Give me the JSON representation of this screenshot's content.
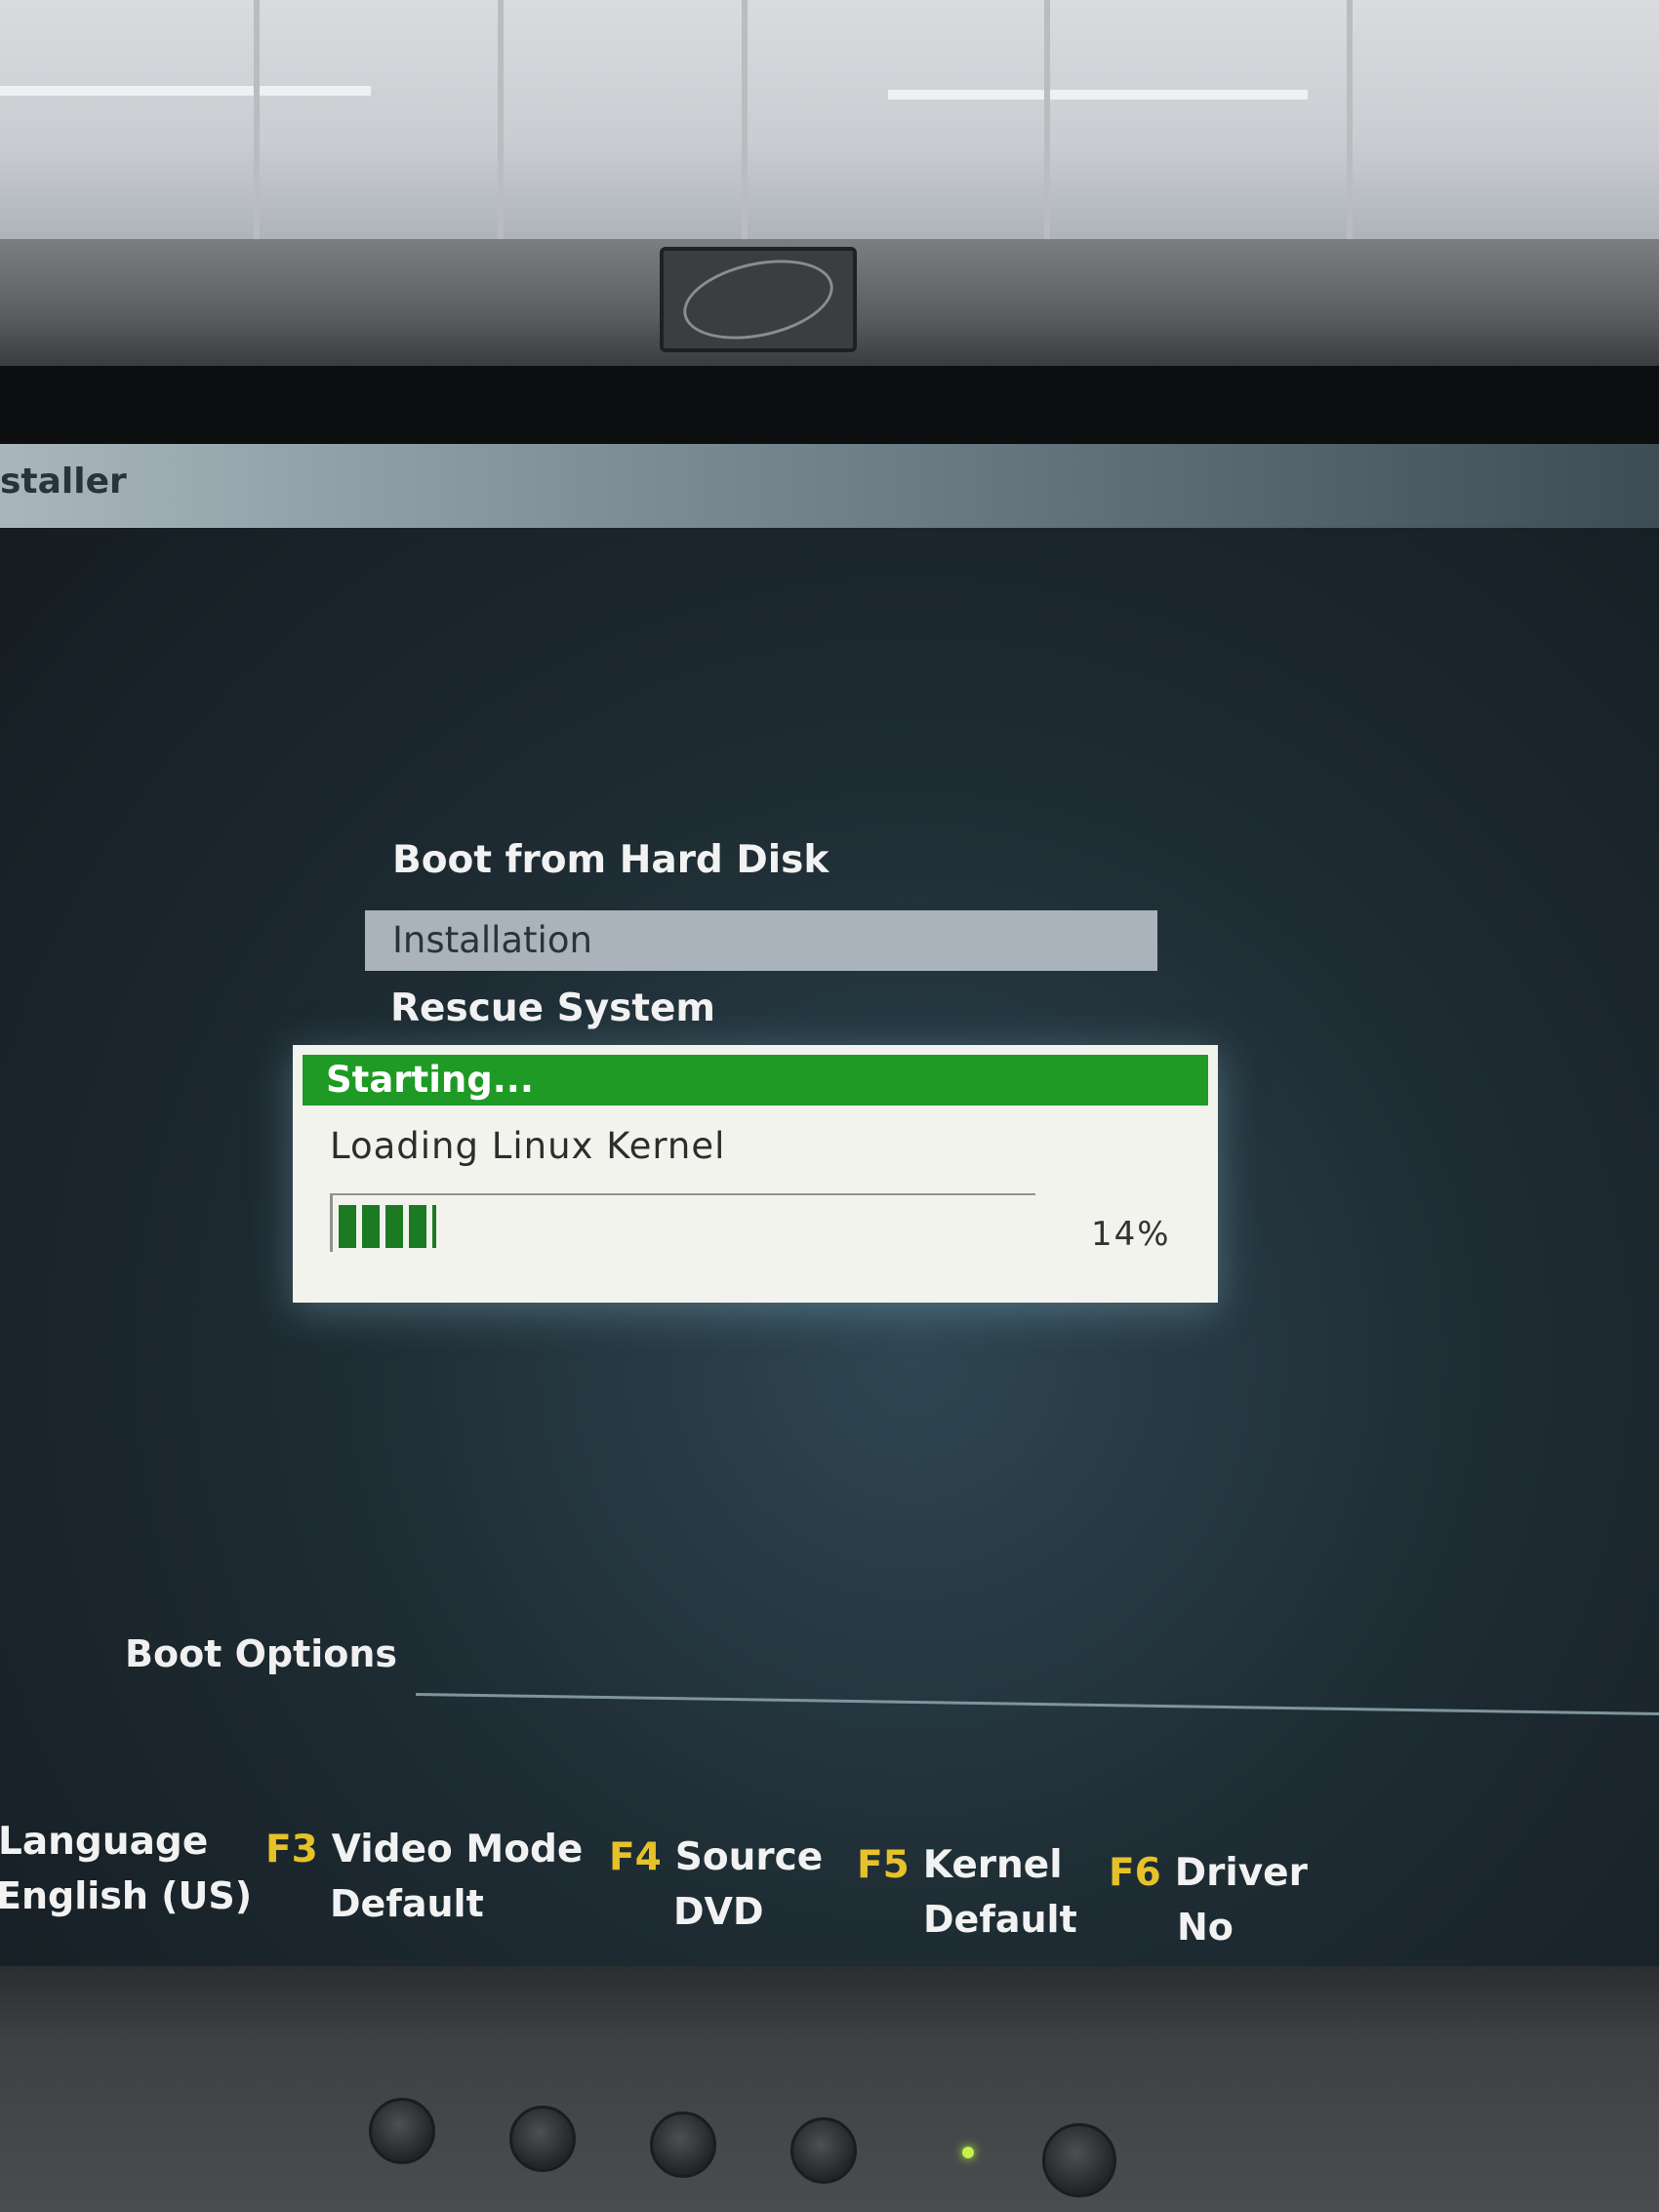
{
  "installer": {
    "title": "staller",
    "menu": {
      "items": [
        "Boot from Hard Disk",
        "Installation",
        "Rescue System"
      ],
      "selected": "Installation"
    },
    "dialog": {
      "header": "Starting...",
      "message": "Loading Linux Kernel",
      "progress_percent": 14,
      "progress_label": "14%"
    },
    "boot_options": {
      "label": "Boot Options"
    },
    "function_keys": [
      {
        "key": "",
        "name": "Language",
        "value": "English (US)"
      },
      {
        "key": "F3",
        "name": "Video Mode",
        "value": "Default"
      },
      {
        "key": "F4",
        "name": "Source",
        "value": "DVD"
      },
      {
        "key": "F5",
        "name": "Kernel",
        "value": "Default"
      },
      {
        "key": "F6",
        "name": "Driver",
        "value": "No"
      }
    ]
  },
  "colors": {
    "progress_green": "#1c7a22",
    "header_green": "#1f9a25",
    "fkey_yellow": "#e6c229",
    "selection_gray": "#aab3bc"
  }
}
